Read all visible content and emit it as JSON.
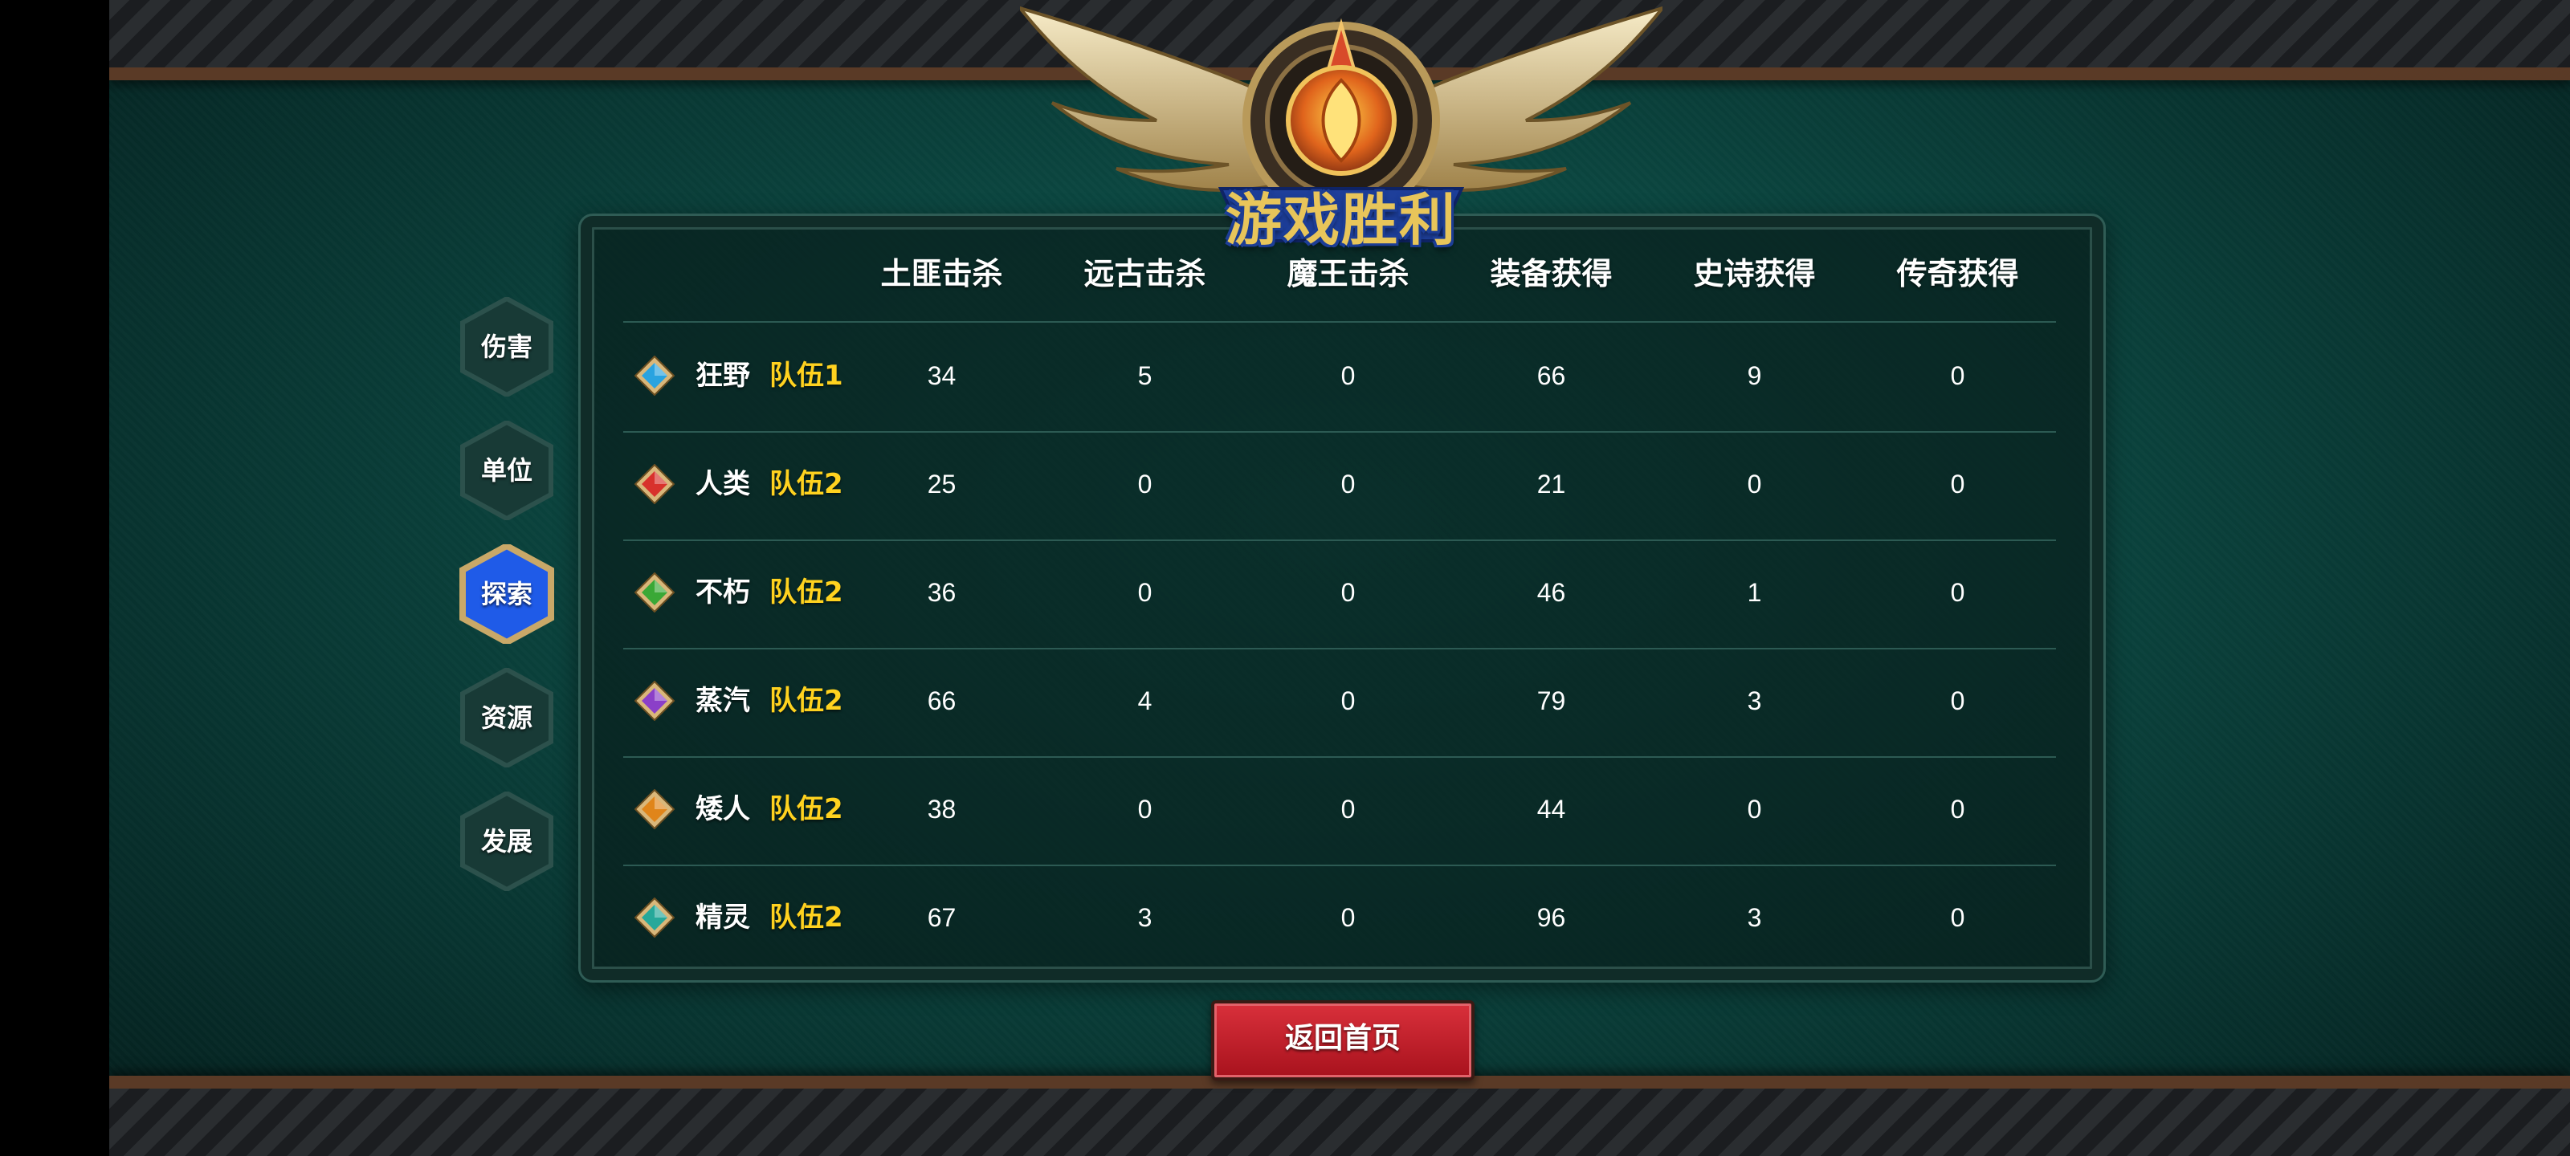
{
  "title": "游戏胜利",
  "tabs": [
    {
      "label": "伤害",
      "active": false
    },
    {
      "label": "单位",
      "active": false
    },
    {
      "label": "探索",
      "active": true
    },
    {
      "label": "资源",
      "active": false
    },
    {
      "label": "发展",
      "active": false
    }
  ],
  "columns": [
    "土匪击杀",
    "远古击杀",
    "魔王击杀",
    "装备获得",
    "史诗获得",
    "传奇获得"
  ],
  "rows": [
    {
      "race": "狂野",
      "team": "队伍1",
      "gem_color": "#2aa3e0",
      "values": [
        "34",
        "5",
        "0",
        "66",
        "9",
        "0"
      ]
    },
    {
      "race": "人类",
      "team": "队伍2",
      "gem_color": "#d8322c",
      "values": [
        "25",
        "0",
        "0",
        "21",
        "0",
        "0"
      ]
    },
    {
      "race": "不朽",
      "team": "队伍2",
      "gem_color": "#3aa836",
      "values": [
        "36",
        "0",
        "0",
        "46",
        "1",
        "0"
      ]
    },
    {
      "race": "蒸汽",
      "team": "队伍2",
      "gem_color": "#8b3fc8",
      "values": [
        "66",
        "4",
        "0",
        "79",
        "3",
        "0"
      ]
    },
    {
      "race": "矮人",
      "team": "队伍2",
      "gem_color": "#e0851a",
      "values": [
        "38",
        "0",
        "0",
        "44",
        "0",
        "0"
      ]
    },
    {
      "race": "精灵",
      "team": "队伍2",
      "gem_color": "#26a89a",
      "values": [
        "67",
        "3",
        "0",
        "96",
        "3",
        "0"
      ]
    }
  ],
  "return_button": "返回首页",
  "colors": {
    "team_text": "#ffd21f",
    "active_tab": "#1f5be8",
    "return_button": "#c7212c"
  }
}
